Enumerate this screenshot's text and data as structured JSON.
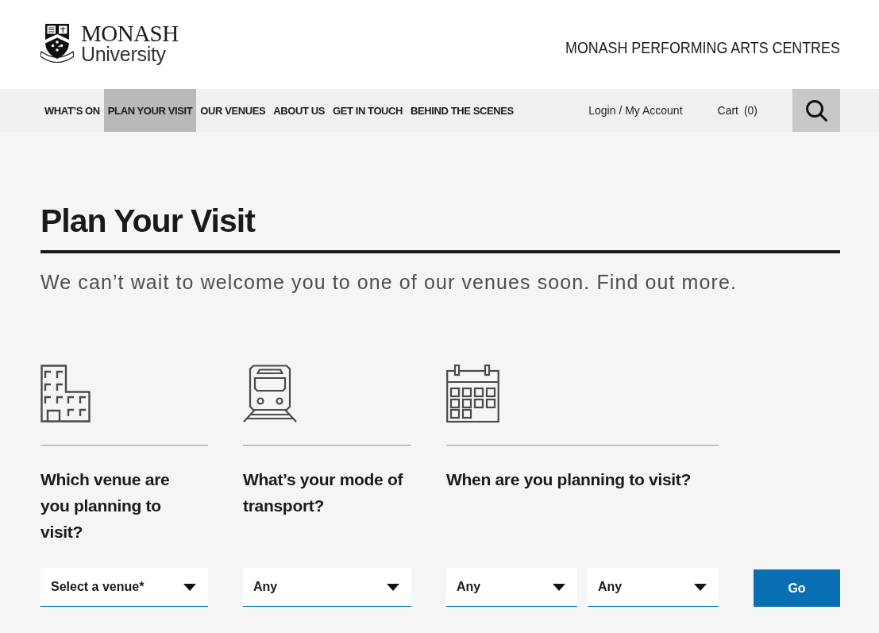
{
  "header": {
    "logo": {
      "wordmark": "MONASH",
      "subtitle": "University"
    },
    "site_title": "MONASH PERFORMING ARTS CENTRES"
  },
  "nav": {
    "items": [
      {
        "label": "WHAT’S ON",
        "selected": false
      },
      {
        "label": "PLAN YOUR VISIT",
        "selected": true
      },
      {
        "label": "OUR VENUES",
        "selected": false
      },
      {
        "label": "ABOUT US",
        "selected": false
      },
      {
        "label": "GET IN TOUCH",
        "selected": false
      },
      {
        "label": "BEHIND THE SCENES",
        "selected": false
      }
    ],
    "account_link": "Login / My Account",
    "cart_link": "Cart (0)"
  },
  "page": {
    "title": "Plan Your Visit",
    "intro": "We can’t wait to welcome you to one of our venues soon. Find out more."
  },
  "planner": {
    "questions": [
      {
        "kind": "venue",
        "question": "Which venue are you planning to visit?",
        "selects": [
          {
            "value": "Select a venue*"
          }
        ]
      },
      {
        "kind": "transport",
        "question": "What’s your mode of transport?",
        "selects": [
          {
            "value": "Any"
          }
        ]
      },
      {
        "kind": "date",
        "question": "When are you planning to visit?",
        "selects": [
          {
            "value": "Any"
          },
          {
            "value": "Any"
          }
        ]
      }
    ],
    "go_button": "Go"
  }
}
